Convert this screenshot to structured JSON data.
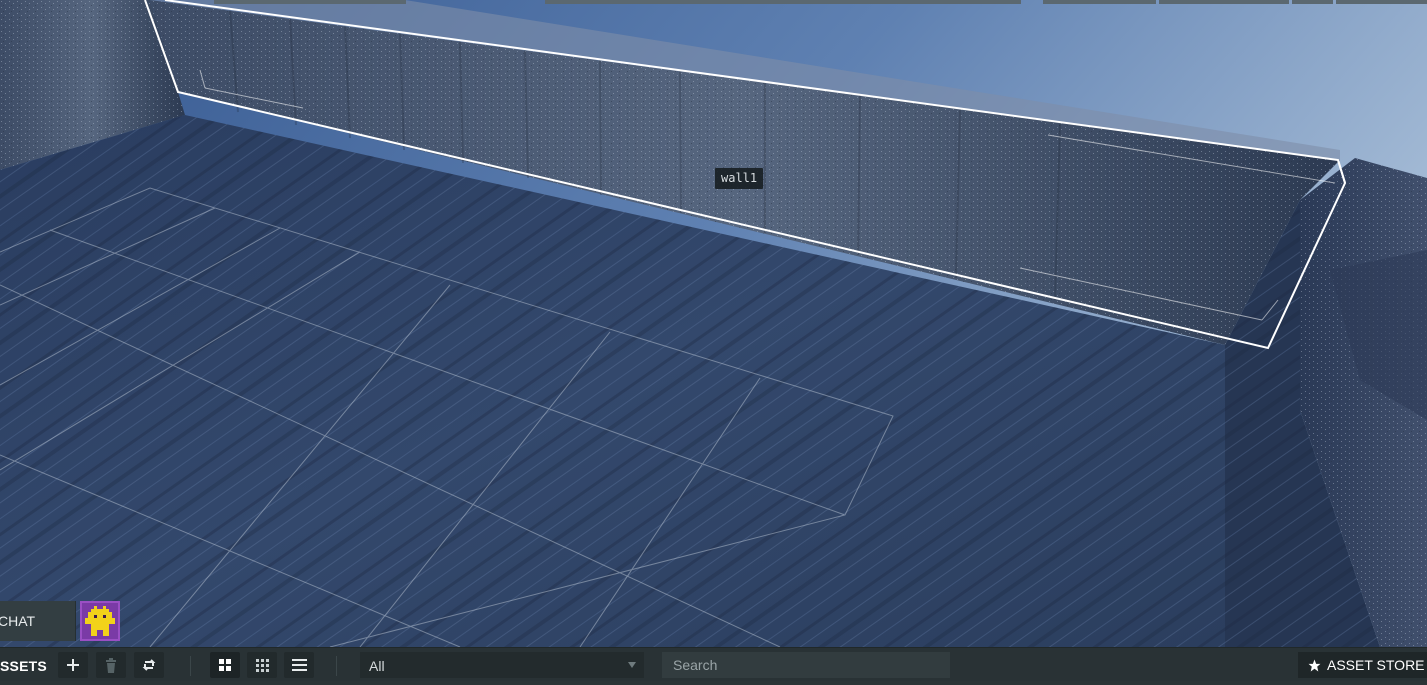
{
  "viewport": {
    "selected_entity_label": "wall1"
  },
  "chat": {
    "tab_label": "CHAT",
    "avatar_icon": "pixel-creature-icon"
  },
  "toolbar": {
    "section_label": "SSETS",
    "add_icon": "plus-icon",
    "delete_icon": "trash-icon",
    "reference_icon": "reference-arrows-icon",
    "view_icons": [
      "grid-large-icon",
      "grid-small-icon",
      "list-icon"
    ],
    "filter": {
      "selected": "All"
    },
    "search": {
      "placeholder": "Search",
      "value": ""
    },
    "store": {
      "label": "ASSET STORE",
      "icon": "star-icon"
    }
  },
  "colors": {
    "sky_top": "#34578f",
    "sky_bottom": "#a9bfd8",
    "floor": "#2f4468",
    "wall": "#4a5b77",
    "selection_outline": "#ffffff",
    "toolbar_bg": "#293235",
    "avatar_frame": "#9a4fc4",
    "avatar_creature": "#f2d21a"
  }
}
